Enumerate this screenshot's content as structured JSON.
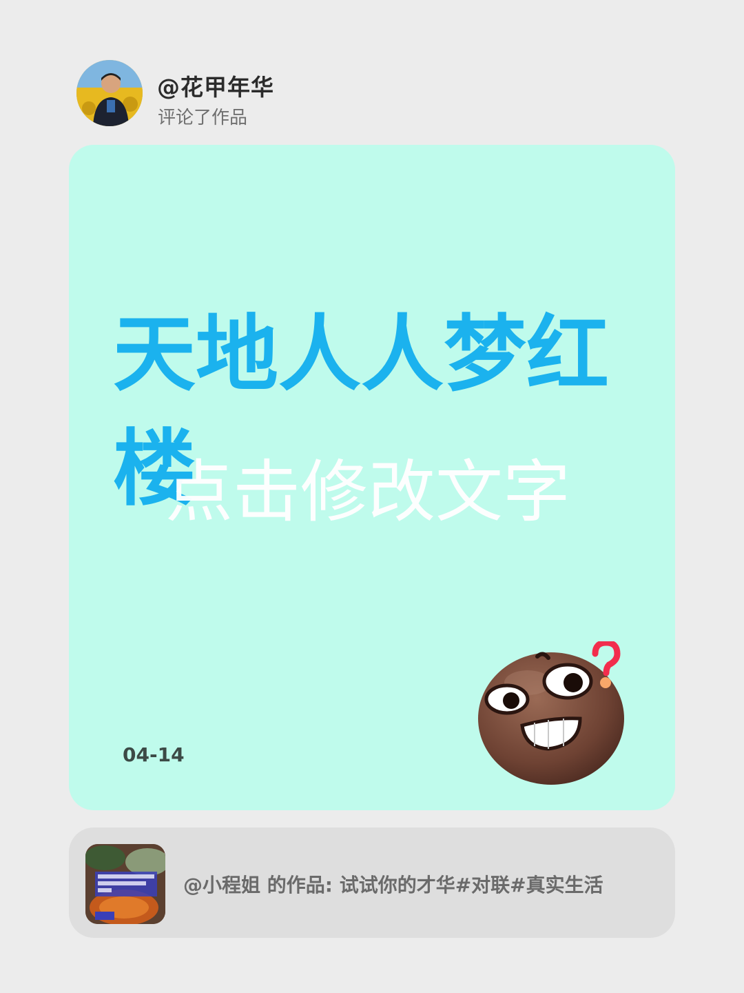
{
  "header": {
    "username": "@花甲年华",
    "action": "评论了作品"
  },
  "card": {
    "comment": "天地人人梦红楼",
    "overlay_hint": "点击修改文字",
    "date": "04-14",
    "background_color": "#bffbec",
    "text_color": "#1bb2ee",
    "sticker_icon": "confused-grin-emoji-icon"
  },
  "work": {
    "text": "@小程姐 的作品: 试试你的才华#对联#真实生活",
    "thumbnail_icon": "food-photo-thumbnail"
  }
}
